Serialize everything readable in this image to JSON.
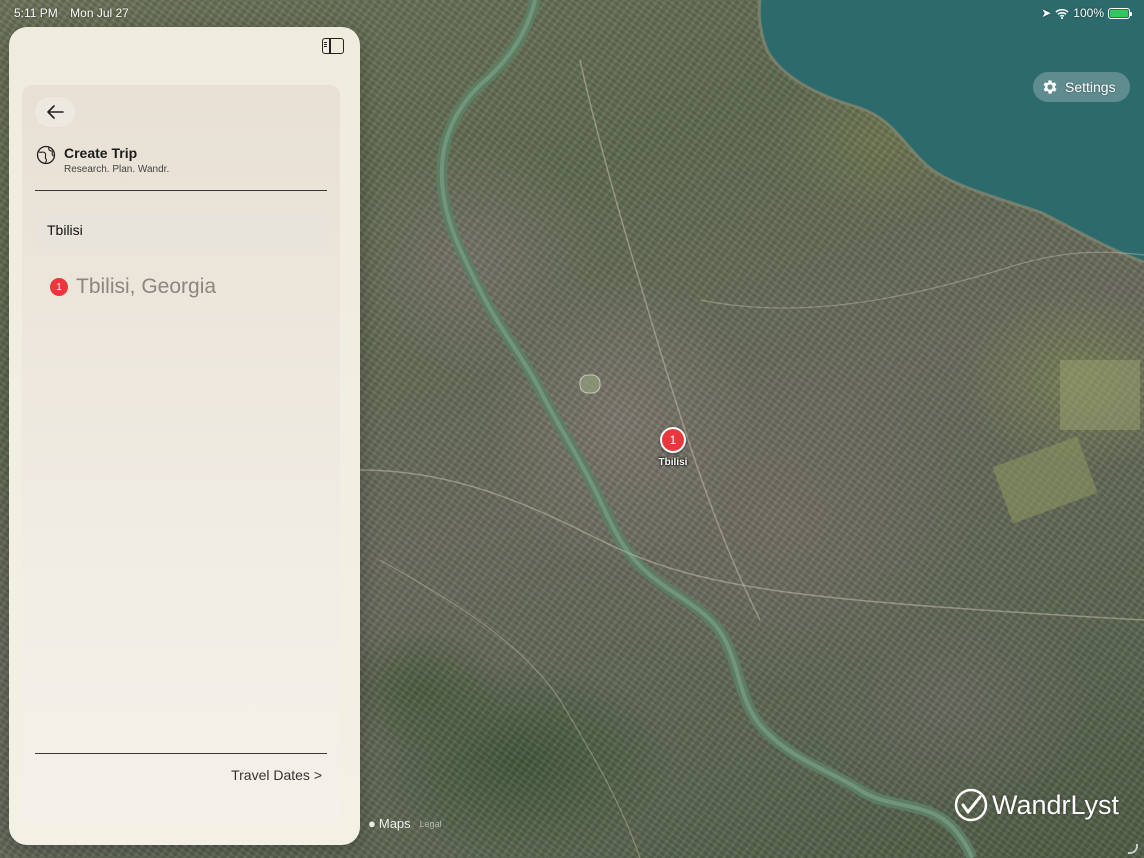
{
  "status_bar": {
    "time": "5:11 PM",
    "date": "Mon Jul 27",
    "battery": "100%"
  },
  "map": {
    "settings_label": "Settings",
    "pin_number": "1",
    "pin_label": "Tbilisi",
    "attribution": "Maps",
    "legal": "Legal",
    "brand": "WandrLyst",
    "colors": {
      "water": "#2c6a6c",
      "pin": "#e8383d"
    }
  },
  "panel": {
    "title": "Create Trip",
    "subtitle": "Research. Plan. Wandr.",
    "search_value": "Tbilisi",
    "results": [
      {
        "number": "1",
        "label": "Tbilisi, Georgia"
      }
    ],
    "travel_dates_label": "Travel Dates >"
  }
}
